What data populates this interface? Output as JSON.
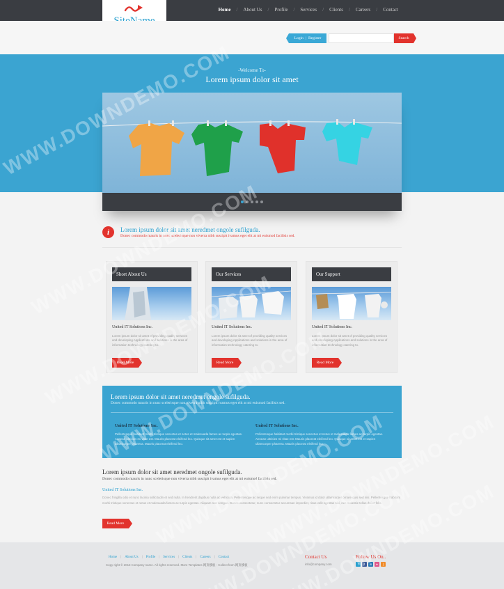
{
  "header": {
    "logo_text": "SiteName",
    "nav": [
      "Home",
      "About Us",
      "Profile",
      "Services",
      "Clients",
      "Careers",
      "Contact"
    ],
    "active_nav": "Home",
    "auth": {
      "login": "Login",
      "register": "Register"
    },
    "search": {
      "value": "",
      "button": "Search"
    }
  },
  "hero": {
    "welcome": "-Welcome To-",
    "title": "Lorem ipsum dolor sit amet",
    "slider_dots": 5,
    "active_dot": 1
  },
  "intro": {
    "icon": "info-icon",
    "title": "Lorem ipsum dolor sit amet neredmet ongole sufilguda.",
    "text": "Donec commodo mauris in nunc scelerisque non viverra nibh suscipit ivamus eget elit at mi euismod facilisis sed."
  },
  "cards": [
    {
      "heading": "Short About Us",
      "subtitle": "United IT Solutions Inc.",
      "text": "Lorem ipsum dolor sit amet of providing quality services and developing Applications and solutions in the area of information technology catering to.",
      "button": "Read More"
    },
    {
      "heading": "Our Services",
      "subtitle": "United IT Solutions Inc.",
      "text": "Lorem ipsum dolor sit amet of providing quality services and developing Applications and solutions in the area of information technology catering to.",
      "button": "Read More"
    },
    {
      "heading": "Our Support",
      "subtitle": "United IT Solutions Inc.",
      "text": "Lorem ipsum dolor sit amet of providing quality services and developing Applications and solutions in the area of information technology catering to.",
      "button": "Read More"
    }
  ],
  "band": {
    "title": "Lorem ipsum dolor sit amet neredmet ongole sufilguda.",
    "text": "Donec commodo mauris in nunc scelerisque non viverra nibh suscipit ivamus eget elit at mi euismod facilisis sed.",
    "columns": [
      {
        "title": "United IT Solutions Inc.",
        "text": "Pellentesque habitant morbi tristique senectus et netus et malesuada fames ac turpis egestas. Aenean ultricies mi vitae est. Mauris placerat eleifend leo. Quisque sit amet est et sapien ullamcorper pharetra. Mauris placerat eleifend leo."
      },
      {
        "title": "United IT Solutions Inc.",
        "text": "Pellentesque habitant morbi tristique senectus et netus et malesuada fames ac turpis egestas. Aenean ultricies mi vitae est. Mauris placerat eleifend leo. Quisque sit amet est et sapien ullamcorper pharetra. Mauris placerat eleifend leo."
      }
    ]
  },
  "article": {
    "title": "Lorem ipsum dolor sit amet neredmet ongole sufilguda.",
    "text": "Donec commodo mauris in nunc scelerisque non viverra nibh suscipit ivamus eget elit at mi euismod facilisis sed.",
    "subtitle": "United IT Solutions Inc.",
    "body": "Donec fringilla odio et nunc lacinia sollicitudin et sed nulla. In hendrerit dapibus nulla ac vehicula. Pellentesque ac neque sed enim pulvinar tempus. Vivamus id dolor ullamcorper ornare quis sed nisi. Pellentesque habitant morbi tristique senectus et netus et malesuada fames ac turpis egestas. Aliquam non congue. Donec consectetur, nunc consectetur accumsan imperdiet, risus velit egestas nisi, nec molestie tellus dui et felis.",
    "button": "Read More"
  },
  "footer": {
    "nav": [
      "Home",
      "About Us",
      "Profile",
      "Services",
      "Clients",
      "Careers",
      "Contact"
    ],
    "copyright": "Copy right © 2013 Company name. All rights reserved. More Templates 网页模板 - Collect from 网页模板",
    "contact_title": "Contact Us",
    "contact_email": "info@company.com",
    "follow_title": "Follow Us On..",
    "social": [
      "twitter-icon",
      "facebook-icon",
      "linkedin-icon",
      "dribbble-icon",
      "rss-icon"
    ]
  },
  "watermark": "WWW.DOWNDEMO.COM",
  "colors": {
    "accent_blue": "#3ba4d1",
    "accent_red": "#e2332d",
    "dark": "#3a3d42"
  }
}
